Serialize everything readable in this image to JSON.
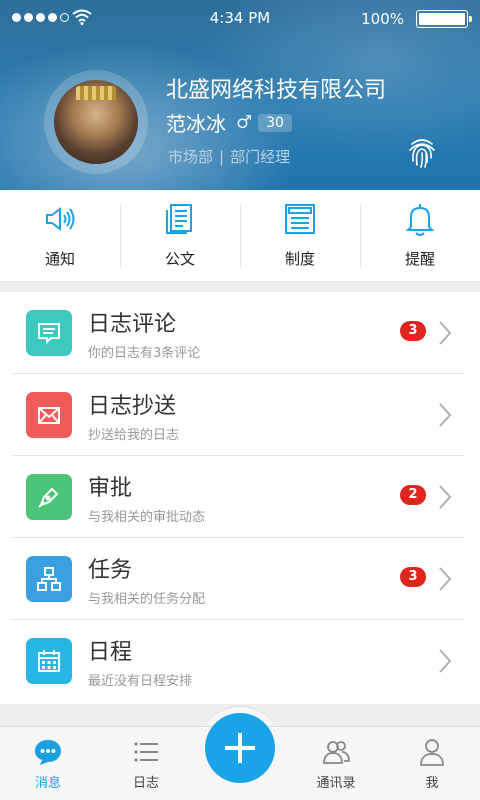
{
  "status_bar": {
    "time": "4:34 PM",
    "battery_percent": "100%",
    "battery_level": 1.0,
    "signal_bars": 4,
    "signal_total": 5
  },
  "profile": {
    "company": "北盛网络科技有限公司",
    "name": "范冰冰",
    "gender_symbol": "♂",
    "age": "30",
    "department": "市场部",
    "separator": "|",
    "position": "部门经理"
  },
  "quick_actions": [
    {
      "label": "通知",
      "icon": "speaker-icon"
    },
    {
      "label": "公文",
      "icon": "document-icon"
    },
    {
      "label": "制度",
      "icon": "regulation-icon"
    },
    {
      "label": "提醒",
      "icon": "bell-icon"
    }
  ],
  "list_items": [
    {
      "title": "日志评论",
      "subtitle": "你的日志有3条评论",
      "badge": "3",
      "icon": "comment-icon",
      "color": "#3dc9c0"
    },
    {
      "title": "日志抄送",
      "subtitle": "抄送给我的日志",
      "badge": "",
      "icon": "mail-icon",
      "color": "#f05a5a"
    },
    {
      "title": "审批",
      "subtitle": "与我相关的审批动态",
      "badge": "2",
      "icon": "pen-icon",
      "color": "#4cc47a"
    },
    {
      "title": "任务",
      "subtitle": "与我相关的任务分配",
      "badge": "3",
      "icon": "hierarchy-icon",
      "color": "#3aa0e0"
    },
    {
      "title": "日程",
      "subtitle": "最近没有日程安排",
      "badge": "",
      "icon": "calendar-icon",
      "color": "#27b6e6"
    }
  ],
  "tab_bar": {
    "tabs": [
      {
        "label": "消息",
        "icon": "chat-bubble-icon",
        "active": true
      },
      {
        "label": "日志",
        "icon": "list-icon",
        "active": false
      },
      {
        "label": "通讯录",
        "icon": "contacts-icon",
        "active": false
      },
      {
        "label": "我",
        "icon": "person-icon",
        "active": false
      }
    ],
    "add_button_icon": "plus-icon"
  },
  "colors": {
    "accent": "#1ba3e8",
    "badge_red": "#e0251f",
    "header_blue": "#2a7bb0"
  }
}
